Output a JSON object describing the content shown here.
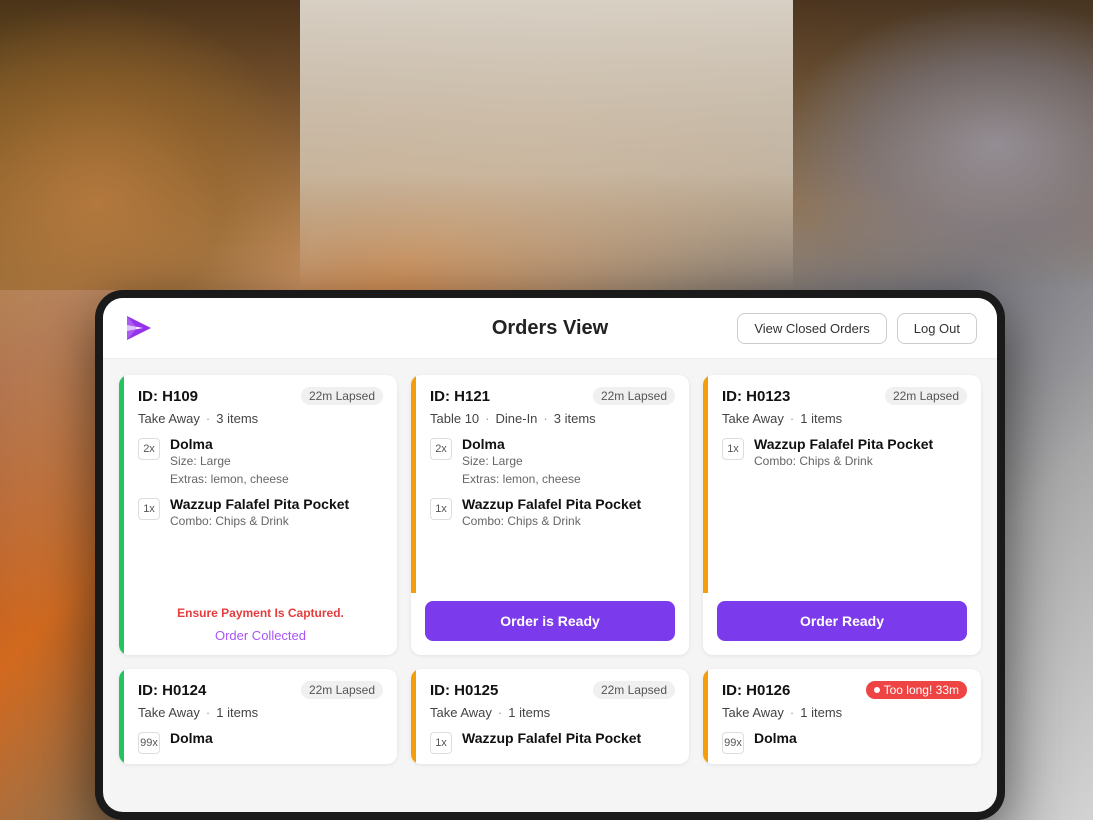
{
  "background": {
    "description": "Chef cooking in kitchen background"
  },
  "header": {
    "title": "Orders View",
    "logo_alt": "app-logo",
    "buttons": {
      "view_closed": "View Closed Orders",
      "log_out": "Log Out"
    }
  },
  "orders": [
    {
      "id": "ID: H109",
      "time": "22m Lapsed",
      "time_type": "normal",
      "type": "Take Away",
      "item_count": "3 items",
      "status_color": "green",
      "items": [
        {
          "qty": "2x",
          "name": "Dolma",
          "details": [
            "Size: Large",
            "Extras: lemon, cheese"
          ]
        },
        {
          "qty": "1x",
          "name": "Wazzup Falafel Pita Pocket",
          "details": [
            "Combo: Chips & Drink"
          ]
        }
      ],
      "payment_warning": "Ensure Payment Is Captured.",
      "footer_text": "Order Collected",
      "footer_type": "collected",
      "button": null
    },
    {
      "id": "ID: H121",
      "time": "22m Lapsed",
      "time_type": "normal",
      "type": "Table 10",
      "dine_in": "Dine-In",
      "item_count": "3 items",
      "status_color": "yellow",
      "items": [
        {
          "qty": "2x",
          "name": "Dolma",
          "details": [
            "Size: Large",
            "Extras: lemon, cheese"
          ]
        },
        {
          "qty": "1x",
          "name": "Wazzup Falafel Pita Pocket",
          "details": [
            "Combo: Chips & Drink"
          ]
        }
      ],
      "payment_warning": null,
      "footer_text": null,
      "footer_type": null,
      "button": "Order is Ready",
      "button_type": "is_ready"
    },
    {
      "id": "ID: H0123",
      "time": "22m Lapsed",
      "time_type": "normal",
      "type": "Take Away",
      "item_count": "1 items",
      "status_color": "yellow",
      "items": [
        {
          "qty": "1x",
          "name": "Wazzup Falafel Pita Pocket",
          "details": [
            "Combo: Chips & Drink"
          ]
        }
      ],
      "payment_warning": null,
      "footer_text": null,
      "footer_type": null,
      "button": "Order Ready",
      "button_type": "ready"
    },
    {
      "id": "ID: H0124",
      "time": "22m Lapsed",
      "time_type": "normal",
      "type": "Take Away",
      "item_count": "1 items",
      "status_color": "green",
      "items": [
        {
          "qty": "99x",
          "name": "Dolma",
          "details": []
        }
      ],
      "partial": true
    },
    {
      "id": "ID: H0125",
      "time": "22m Lapsed",
      "time_type": "normal",
      "type": "Take Away",
      "item_count": "1 items",
      "status_color": "yellow",
      "items": [
        {
          "qty": "1x",
          "name": "Wazzup Falafel Pita Pocket",
          "details": []
        }
      ],
      "partial": true
    },
    {
      "id": "ID: H0126",
      "time": "Too long! 33m",
      "time_type": "red",
      "type": "Take Away",
      "item_count": "1 items",
      "status_color": "yellow",
      "items": [
        {
          "qty": "99x",
          "name": "Dolma",
          "details": []
        }
      ],
      "partial": true
    }
  ]
}
